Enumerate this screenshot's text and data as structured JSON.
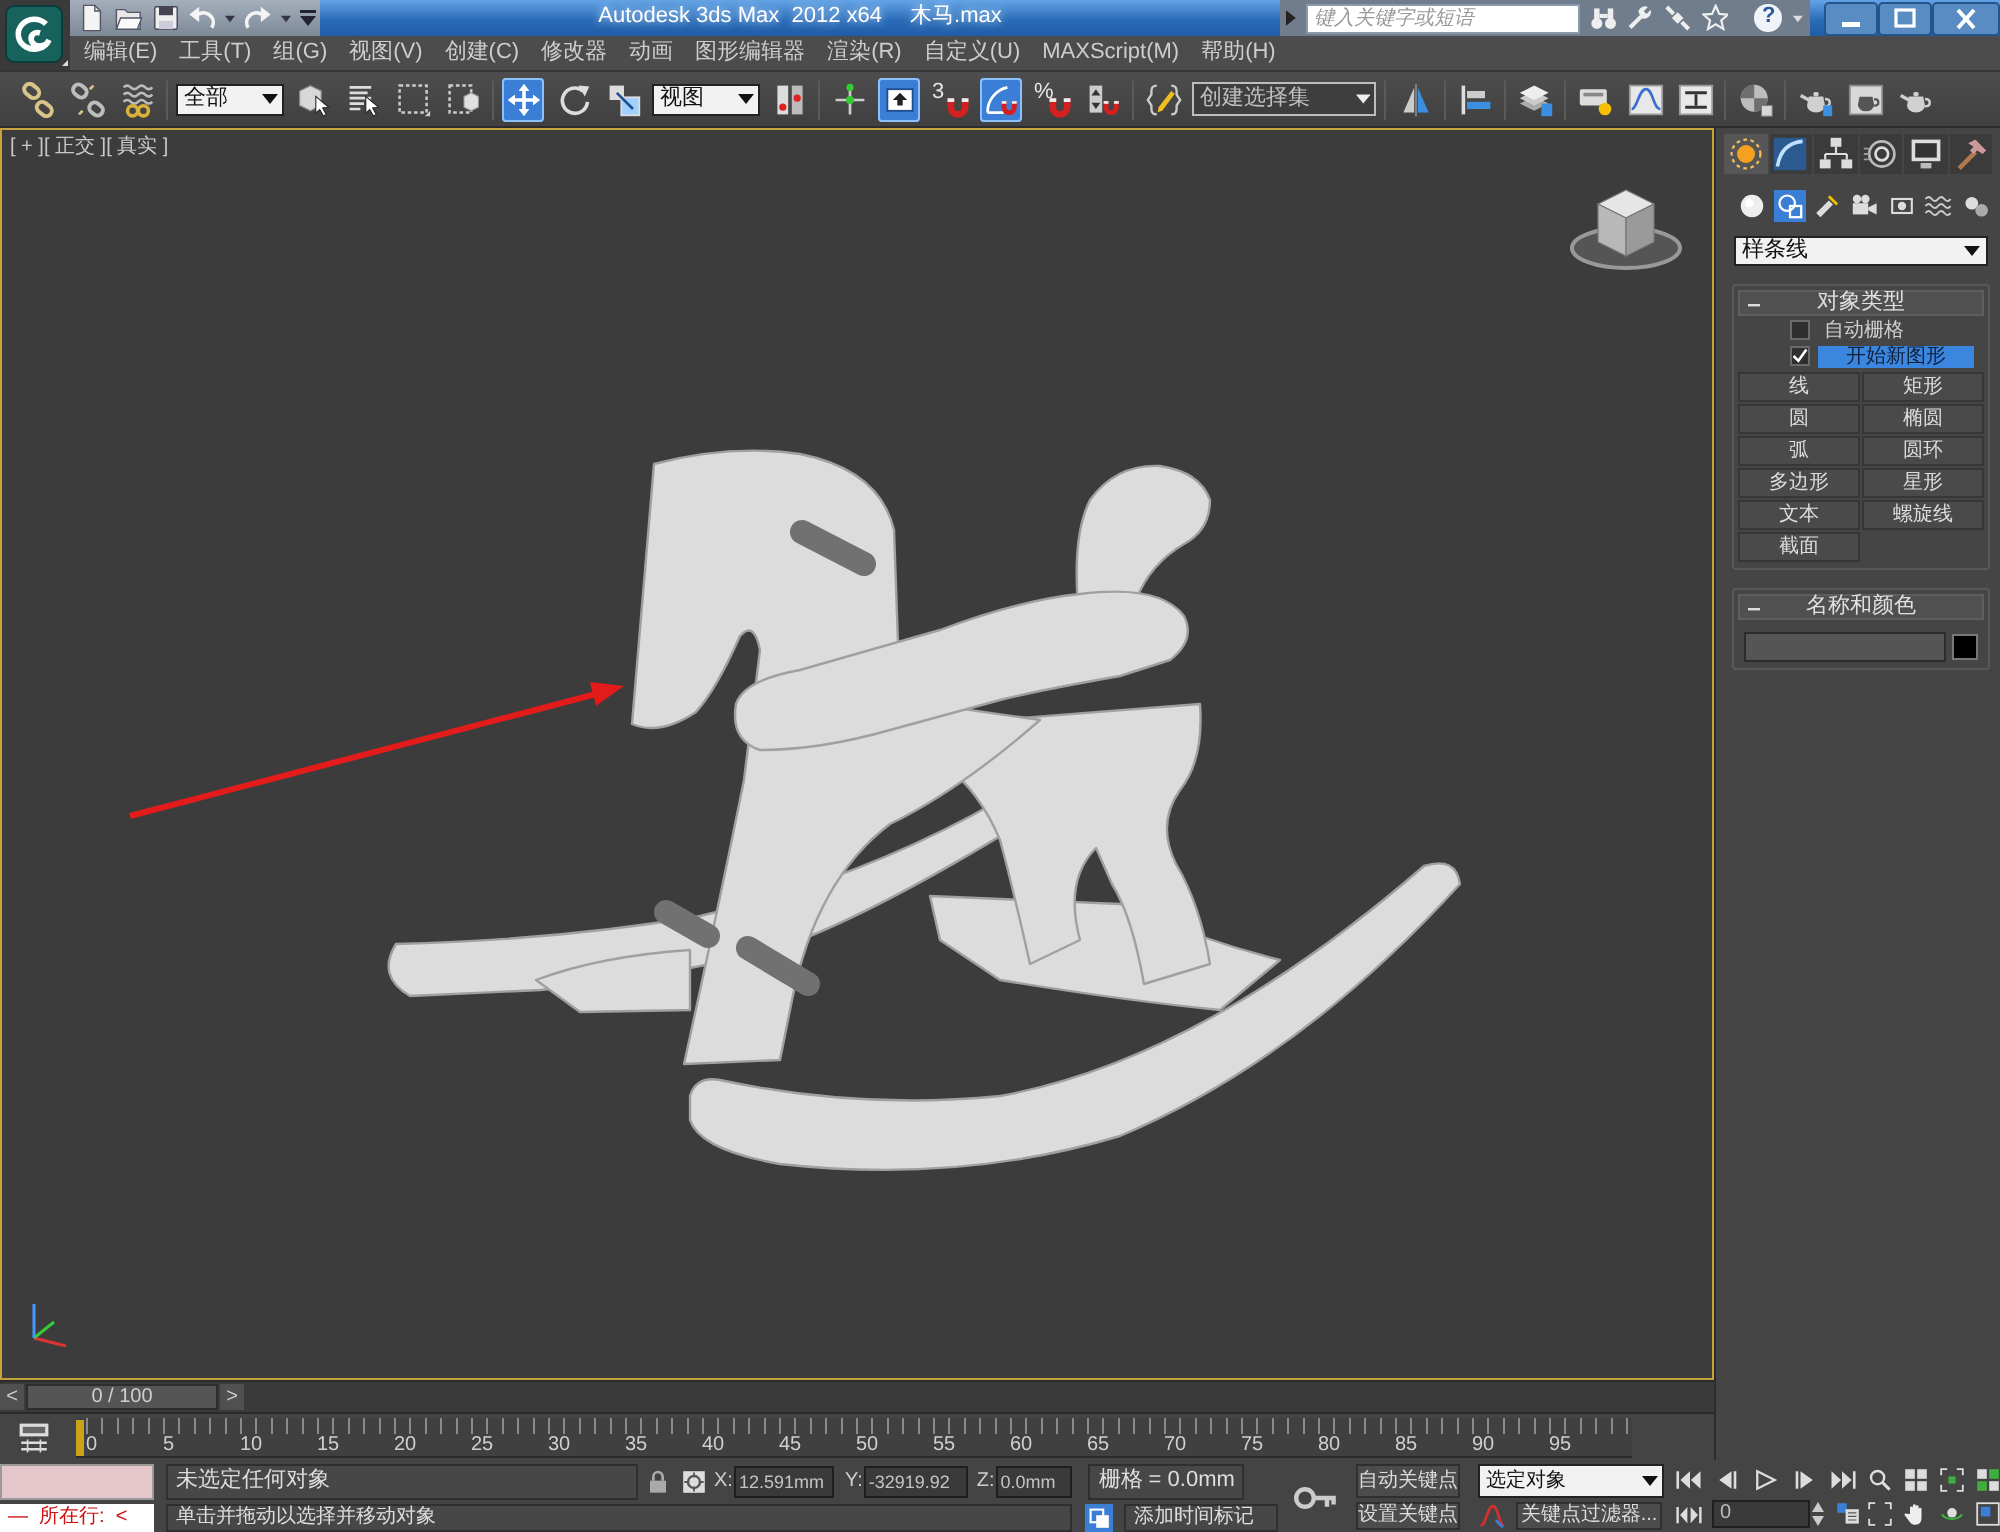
{
  "title_bar": {
    "title": "Autodesk 3ds Max  2012 x64",
    "document": "木马.max",
    "search": {
      "placeholder": "键入关键字或短语"
    },
    "help": "?"
  },
  "menu": [
    {
      "label": "编辑(E)"
    },
    {
      "label": "工具(T)"
    },
    {
      "label": "组(G)"
    },
    {
      "label": "视图(V)"
    },
    {
      "label": "创建(C)"
    },
    {
      "label": "修改器"
    },
    {
      "label": "动画"
    },
    {
      "label": "图形编辑器"
    },
    {
      "label": "渲染(R)"
    },
    {
      "label": "自定义(U)"
    },
    {
      "label": "MAXScript(M)"
    },
    {
      "label": "帮助(H)"
    }
  ],
  "main_toolbar": [
    {
      "items": [
        {
          "kind": "tool",
          "selected": false
        },
        {
          "kind": "tool",
          "selected": false
        },
        {
          "kind": "tool",
          "selected": false
        }
      ]
    },
    {
      "items": [
        {
          "kind": "dropdown",
          "value": "全部"
        },
        {
          "kind": "tool",
          "selected": false
        },
        {
          "kind": "tool",
          "selected": false
        },
        {
          "kind": "tool",
          "selected": false
        },
        {
          "kind": "tool",
          "selected": false
        }
      ]
    },
    {
      "items": [
        {
          "kind": "tool",
          "selected": true
        },
        {
          "kind": "tool",
          "selected": false
        },
        {
          "kind": "tool",
          "selected": false
        },
        {
          "kind": "dropdown",
          "value": "视图"
        },
        {
          "kind": "tool",
          "selected": false
        }
      ]
    },
    {
      "items": [
        {
          "kind": "tool",
          "selected": false
        },
        {
          "kind": "tool",
          "selected": true
        },
        {
          "kind": "tool",
          "label": "3",
          "selected": false
        },
        {
          "kind": "tool",
          "selected": true
        },
        {
          "kind": "tool",
          "label": "%",
          "selected": false
        },
        {
          "kind": "tool",
          "selected": false
        }
      ]
    },
    {
      "items": [
        {
          "kind": "tool",
          "selected": false
        },
        {
          "kind": "combo",
          "placeholder": "创建选择集"
        }
      ]
    },
    {
      "items": [
        {
          "kind": "tool",
          "selected": false
        }
      ]
    },
    {
      "items": [
        {
          "kind": "tool",
          "selected": false
        }
      ]
    },
    {
      "items": [
        {
          "kind": "tool",
          "selected": false
        }
      ]
    },
    {
      "items": [
        {
          "kind": "tool",
          "selected": false
        },
        {
          "kind": "tool",
          "selected": false
        },
        {
          "kind": "tool",
          "selected": false
        }
      ]
    },
    {
      "items": [
        {
          "kind": "tool",
          "selected": false
        }
      ]
    },
    {
      "items": [
        {
          "kind": "tool",
          "selected": false
        },
        {
          "kind": "tool",
          "selected": false
        },
        {
          "kind": "tool",
          "selected": false
        }
      ]
    }
  ],
  "viewport": {
    "label": "[ + ][ 正交 ][ 真实 ]",
    "active": true
  },
  "command_panel": {
    "tabs": [
      {
        "selected": true
      },
      {
        "selected": false
      },
      {
        "selected": false
      },
      {
        "selected": false
      },
      {
        "selected": false
      },
      {
        "selected": false
      }
    ],
    "categories": [
      {
        "selected": false
      },
      {
        "selected": true
      },
      {
        "selected": false
      },
      {
        "selected": false
      },
      {
        "selected": false
      },
      {
        "selected": false
      },
      {
        "selected": false
      }
    ],
    "category_dropdown": "样条线",
    "rollouts": [
      {
        "kind": "object_type",
        "title": "对象类型",
        "expanded": true,
        "options": [
          {
            "label": "自动栅格",
            "checked": false,
            "highlighted": false
          },
          {
            "label": "开始新图形",
            "checked": true,
            "highlighted": true
          }
        ],
        "buttons": [
          {
            "label": "线",
            "selected": false
          },
          {
            "label": "矩形",
            "selected": false
          },
          {
            "label": "圆",
            "selected": false
          },
          {
            "label": "椭圆",
            "selected": false
          },
          {
            "label": "弧",
            "selected": false
          },
          {
            "label": "圆环",
            "selected": false
          },
          {
            "label": "多边形",
            "selected": false
          },
          {
            "label": "星形",
            "selected": false
          },
          {
            "label": "文本",
            "selected": false
          },
          {
            "label": "螺旋线",
            "selected": false
          },
          {
            "label": "截面",
            "selected": false
          }
        ]
      },
      {
        "kind": "name_and_color",
        "title": "名称和颜色",
        "expanded": true,
        "color": "#000000"
      }
    ]
  },
  "time_slider": {
    "previous": "<",
    "position": "0 / 100",
    "next": ">",
    "level": 0
  },
  "trackbar": {
    "labels": [
      "0",
      "5",
      "10",
      "15",
      "20",
      "25",
      "30",
      "35",
      "40",
      "45",
      "50",
      "55",
      "60",
      "65",
      "70",
      "75",
      "80",
      "85",
      "90",
      "95"
    ],
    "level": 0
  },
  "status_bar": {
    "listener": {
      "output": "—  所在行:  <"
    },
    "prompt": "未选定任何对象",
    "hint": "单击并拖动以选择并移动对象",
    "coordinates": [
      {
        "axis": "X:",
        "value": "12.591mm"
      },
      {
        "axis": "Y:",
        "value": "-32919.92"
      },
      {
        "axis": "Z:",
        "value": "0.0mm"
      }
    ],
    "grid": "栅格 = 0.0mm",
    "time_tag": "添加时间标记",
    "auto_key": {
      "label": "自动关键点",
      "on": false
    },
    "set_key": "设置关键点",
    "key_selection": "选定对象",
    "key_filters": "关键点过滤器...",
    "frame": "0"
  }
}
